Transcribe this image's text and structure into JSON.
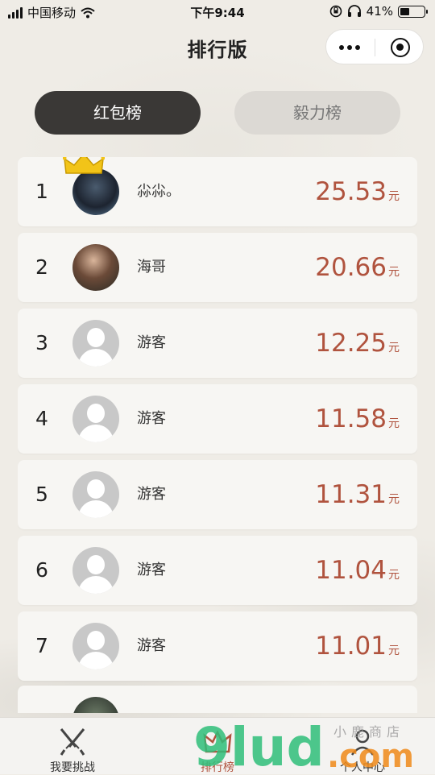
{
  "status_bar": {
    "carrier": "中国移动",
    "time": "下午9:44",
    "battery_percent": "41%",
    "battery_level": 0.41
  },
  "nav": {
    "title": "排行版",
    "more_icon": "more-dots-icon",
    "close_icon": "target-circle-icon"
  },
  "tabs": [
    {
      "label": "红包榜",
      "active": true
    },
    {
      "label": "毅力榜",
      "active": false
    }
  ],
  "leaderboard": {
    "unit": "元",
    "rows": [
      {
        "rank": "1",
        "name": "尛尛。",
        "amount": "25.53",
        "avatar": "photo",
        "crown": true
      },
      {
        "rank": "2",
        "name": "海哥",
        "amount": "20.66",
        "avatar": "photo"
      },
      {
        "rank": "3",
        "name": "游客",
        "amount": "12.25",
        "avatar": "default-user-icon"
      },
      {
        "rank": "4",
        "name": "游客",
        "amount": "11.58",
        "avatar": "default-user-icon"
      },
      {
        "rank": "5",
        "name": "游客",
        "amount": "11.31",
        "avatar": "default-user-icon"
      },
      {
        "rank": "6",
        "name": "游客",
        "amount": "11.04",
        "avatar": "default-user-icon"
      },
      {
        "rank": "7",
        "name": "游客",
        "amount": "11.01",
        "avatar": "default-user-icon"
      }
    ]
  },
  "tabbar": [
    {
      "label": "我要挑战",
      "icon": "crossed-swords-icon",
      "active": false
    },
    {
      "label": "排行榜",
      "icon": "crown-icon",
      "active": true
    },
    {
      "label": "个人中心",
      "icon": "person-icon",
      "active": false
    }
  ],
  "watermark": {
    "text": "9lud",
    "suffix": ".com",
    "shop": "小鹿商店"
  },
  "colors": {
    "accent": "#b0533e",
    "active_tab": "#3a3836",
    "background": "#efece6"
  }
}
